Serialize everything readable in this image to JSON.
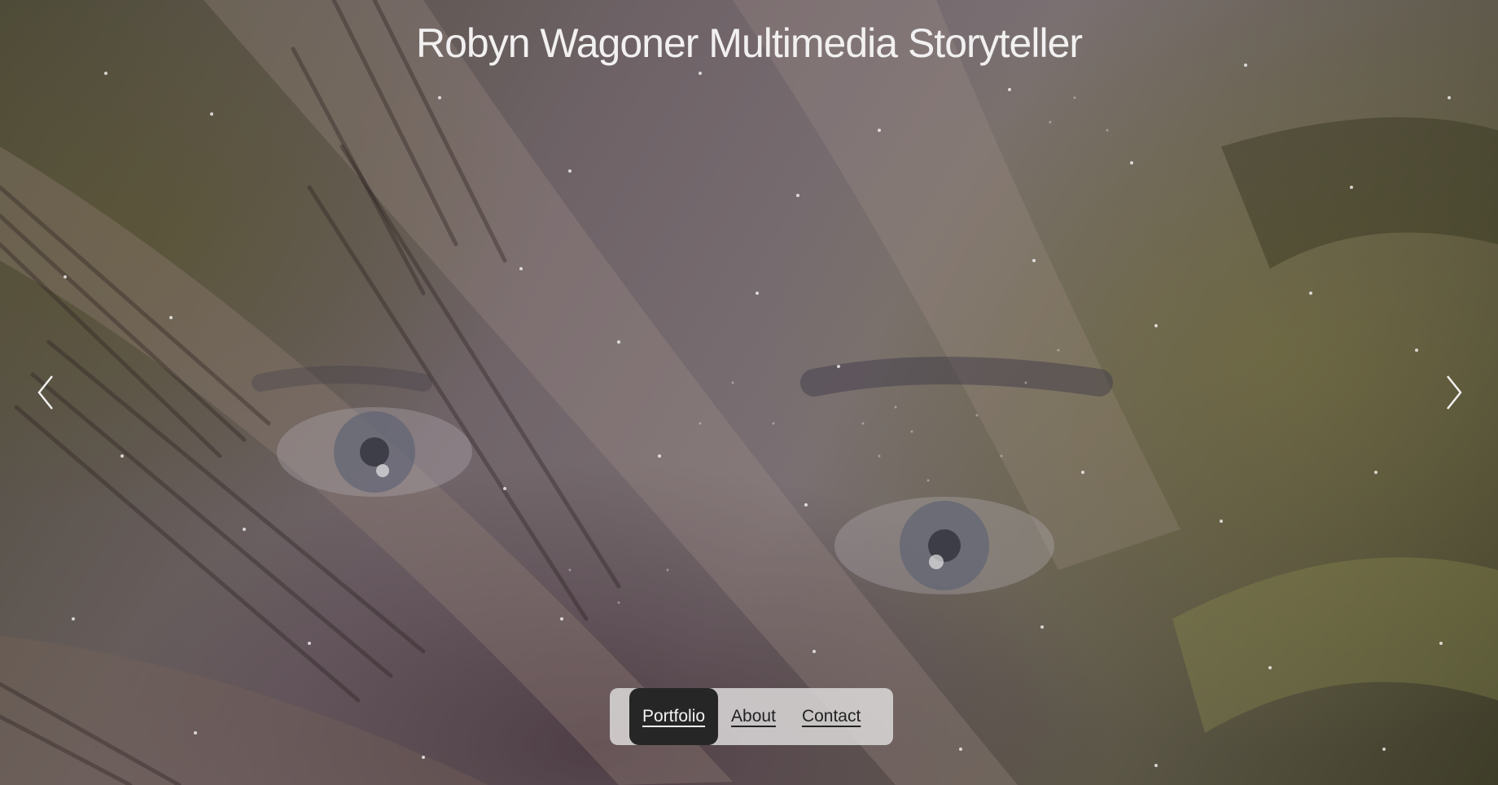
{
  "site": {
    "title": "Robyn Wagoner Multimedia Storyteller"
  },
  "hero": {
    "description_icon": "photo-collage",
    "prev_icon": "chevron-left-icon",
    "next_icon": "chevron-right-icon"
  },
  "nav": {
    "items": [
      {
        "label": "Portfolio",
        "active": true
      },
      {
        "label": "About",
        "active": false
      },
      {
        "label": "Contact",
        "active": false
      }
    ]
  },
  "colors": {
    "title": "#f2f0f0",
    "nav_background": "#e1dede",
    "nav_active_background": "#262626",
    "nav_text": "#222222",
    "nav_active_text": "#f4f4f4"
  }
}
